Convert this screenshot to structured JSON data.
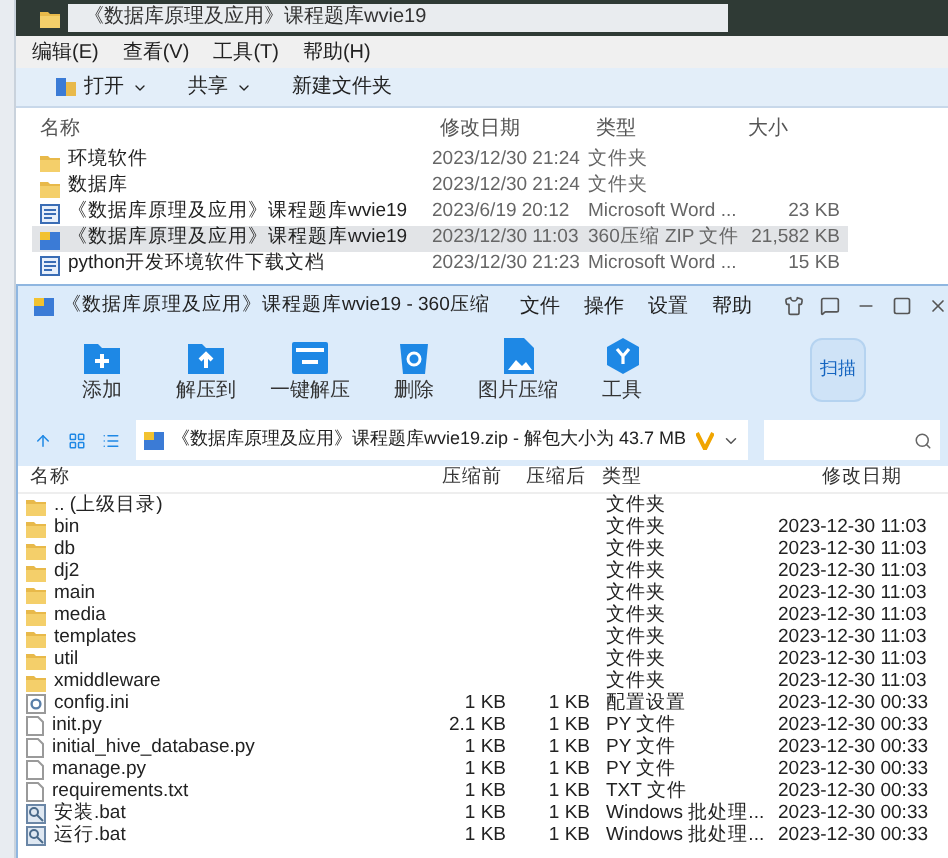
{
  "explorer": {
    "path": "《数据库原理及应用》课程题库wvie19",
    "menu": [
      "编辑(E)",
      "查看(V)",
      "工具(T)",
      "帮助(H)"
    ],
    "toolbar": [
      {
        "label": "打开",
        "kind": "open"
      },
      {
        "label": "共享",
        "kind": "menu"
      },
      {
        "label": "新建文件夹",
        "kind": "plain"
      }
    ],
    "columns": [
      "名称",
      "修改日期",
      "类型",
      "大小"
    ],
    "rows": [
      {
        "kind": "folder",
        "name": "环境软件",
        "date": "2023/12/30 21:24",
        "type": "文件夹",
        "selected": false
      },
      {
        "kind": "folder",
        "name": "数据库",
        "date": "2023/12/30 21:24",
        "type": "文件夹",
        "selected": false
      },
      {
        "kind": "word",
        "name": "《数据库原理及应用》课程题库wvie19",
        "date": "2023/6/19 20:12",
        "type": "Microsoft Word ...",
        "size": "23 KB",
        "selected": false
      },
      {
        "kind": "zip",
        "name": "《数据库原理及应用》课程题库wvie19",
        "date": "2023/12/30 11:03",
        "type": "360压缩 ZIP 文件",
        "size": "21,582 KB",
        "selected": true
      },
      {
        "kind": "word",
        "name": "python开发环境软件下载文档",
        "date": "2023/12/30 21:23",
        "type": "Microsoft Word ...",
        "size": "15 KB",
        "selected": false
      }
    ]
  },
  "archive": {
    "title": "《数据库原理及应用》课程题库wvie19 - 360压缩",
    "menu": [
      "文件",
      "操作",
      "设置",
      "帮助"
    ],
    "tools": [
      {
        "label": "添加",
        "kind": "add"
      },
      {
        "label": "解压到",
        "kind": "extract"
      },
      {
        "label": "一键解压",
        "kind": "onekey"
      },
      {
        "label": "删除",
        "kind": "delete"
      },
      {
        "label": "图片压缩",
        "kind": "image"
      },
      {
        "label": "工具",
        "kind": "tools"
      }
    ],
    "scan": "扫描",
    "address": "《数据库原理及应用》课程题库wvie19.zip - 解包大小为 43.7 MB",
    "columns": [
      "名称",
      "压缩前",
      "压缩后",
      "类型",
      "修改日期"
    ],
    "rows": [
      {
        "kind": "folder",
        "name": ".. (上级目录)",
        "type": "文件夹"
      },
      {
        "kind": "folder",
        "name": "bin",
        "type": "文件夹",
        "date": "2023-12-30 11:03"
      },
      {
        "kind": "folder",
        "name": "db",
        "type": "文件夹",
        "date": "2023-12-30 11:03"
      },
      {
        "kind": "folder",
        "name": "dj2",
        "type": "文件夹",
        "date": "2023-12-30 11:03"
      },
      {
        "kind": "folder",
        "name": "main",
        "type": "文件夹",
        "date": "2023-12-30 11:03"
      },
      {
        "kind": "folder",
        "name": "media",
        "type": "文件夹",
        "date": "2023-12-30 11:03"
      },
      {
        "kind": "folder",
        "name": "templates",
        "type": "文件夹",
        "date": "2023-12-30 11:03"
      },
      {
        "kind": "folder",
        "name": "util",
        "type": "文件夹",
        "date": "2023-12-30 11:03"
      },
      {
        "kind": "folder",
        "name": "xmiddleware",
        "type": "文件夹",
        "date": "2023-12-30 11:03"
      },
      {
        "kind": "settings",
        "name": "config.ini",
        "before": "1 KB",
        "after": "1 KB",
        "type": "配置设置",
        "date": "2023-12-30 00:33"
      },
      {
        "kind": "file",
        "name": "init.py",
        "before": "2.1 KB",
        "after": "1 KB",
        "type": "PY 文件",
        "date": "2023-12-30 00:33"
      },
      {
        "kind": "file",
        "name": "initial_hive_database.py",
        "before": "1 KB",
        "after": "1 KB",
        "type": "PY 文件",
        "date": "2023-12-30 00:33"
      },
      {
        "kind": "file",
        "name": "manage.py",
        "before": "1 KB",
        "after": "1 KB",
        "type": "PY 文件",
        "date": "2023-12-30 00:33"
      },
      {
        "kind": "file",
        "name": "requirements.txt",
        "before": "1 KB",
        "after": "1 KB",
        "type": "TXT 文件",
        "date": "2023-12-30 00:33"
      },
      {
        "kind": "batch",
        "name": "安装.bat",
        "before": "1 KB",
        "after": "1 KB",
        "type": "Windows 批处理...",
        "date": "2023-12-30 00:33"
      },
      {
        "kind": "batch",
        "name": "运行.bat",
        "before": "1 KB",
        "after": "1 KB",
        "type": "Windows 批处理...",
        "date": "2023-12-30 00:33"
      }
    ]
  }
}
